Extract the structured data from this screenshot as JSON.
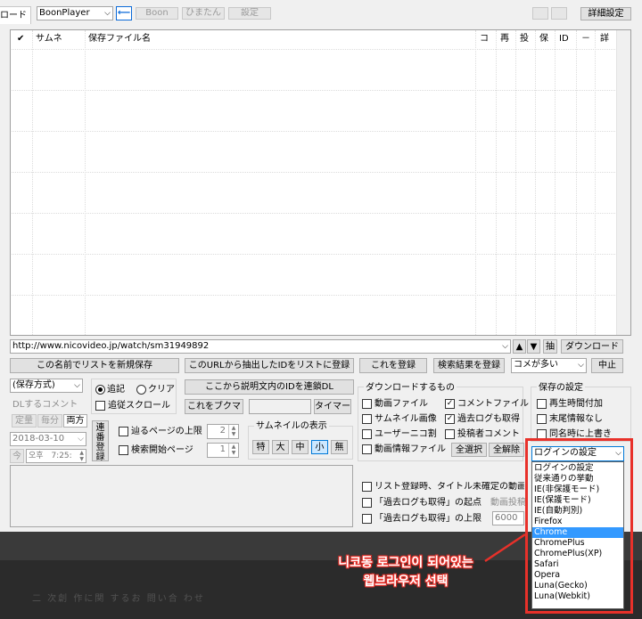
{
  "toolbar": {
    "tab_label": "ロード",
    "player_select": "BoonPlayer",
    "boon_button": "Boon",
    "himatan_button": "ひまたん",
    "settei_button": "設定",
    "advanced_settings": "詳細設定"
  },
  "table": {
    "headers": [
      "✔",
      "サムネ",
      "保存ファイル名",
      "コ",
      "再",
      "投",
      "保",
      "ID",
      "－",
      "詳"
    ]
  },
  "url_bar": {
    "url": "http://www.nicovideo.jp/watch/sm31949892",
    "up_arrow": "▲",
    "down_arrow": "▼",
    "extract_label": "抽",
    "download_button": "ダウンロード"
  },
  "actions": {
    "save_new_list": "この名前でリストを新規保存",
    "register_ids_from_url": "このURLから抽出したIDをリストに登録",
    "register_this": "これを登録",
    "register_search_results": "検索結果を登録",
    "comment_select": "コメが多い",
    "stop_button": "中止",
    "save_method_select": "(保存方式)",
    "radio_append": "追記",
    "radio_clear": "クリア",
    "follow_scroll": "追従スクロール",
    "serial_dl_from_description": "ここから説明文内のIDを連鎖DL",
    "bookmark_this": "これをブクマ",
    "timer_button": "タイマー"
  },
  "comments_panel": {
    "label": "DLするコメント",
    "fixed_count": "定量",
    "per_minute": "毎分",
    "both": "両方",
    "date": "2018-03-10",
    "now_button": "今",
    "ampm": "오후",
    "time": "7:25:",
    "renban_register": "連番登録"
  },
  "paging": {
    "follow_page_limit": "辿るページの上限",
    "follow_page_limit_value": "2",
    "search_start_page": "検索開始ページ",
    "search_start_page_value": "1"
  },
  "thumbnail_display": {
    "title": "サムネイルの表示",
    "options": [
      "特",
      "大",
      "中",
      "小",
      "無"
    ],
    "selected_index": 3
  },
  "download_items": {
    "title": "ダウンロードするもの",
    "video_file": "動画ファイル",
    "comment_file": "コメントファイル",
    "thumbnail_image": "サムネイル画像",
    "past_log": "過去ログも取得",
    "user_nico": "ユーザーニコ割",
    "poster_comment": "投稿者コメント",
    "video_info_file": "動画情報ファイル",
    "select_all": "全選択",
    "deselect_all": "全解除"
  },
  "save_settings": {
    "title": "保存の設定",
    "add_playback_time": "再生時間付加",
    "end_info_none": "末尾情報なし",
    "save_simultaneously": "同名時に上書き"
  },
  "bottom_options": {
    "list_register_title_note": "リスト登録時、タイトル未確定の動画は",
    "past_log_start_point": "「過去ログも取得」の起点",
    "video_post_label": "動画投稿",
    "past_log_limit": "「過去ログも取得」の上限",
    "past_log_limit_value": "6000"
  },
  "login_dropdown": {
    "current": "ログインの設定",
    "items": [
      "ログインの設定",
      "従来通りの挙動",
      "IE(非保護モード)",
      "IE(保護モード)",
      "IE(自動判別)",
      "Firefox",
      "Chrome",
      "ChromePlus",
      "ChromePlus(XP)",
      "Safari",
      "Opera",
      "Luna(Gecko)",
      "Luna(Webkit)"
    ],
    "selected_index": 6
  },
  "annotation": {
    "line1": "니코동 로그인이 되어있는",
    "line2": "웹브라우저 선택",
    "color": "#e8312a"
  },
  "taskbar": {
    "blurred_text": "二 次創 作に関 するお 問い合 わせ"
  }
}
